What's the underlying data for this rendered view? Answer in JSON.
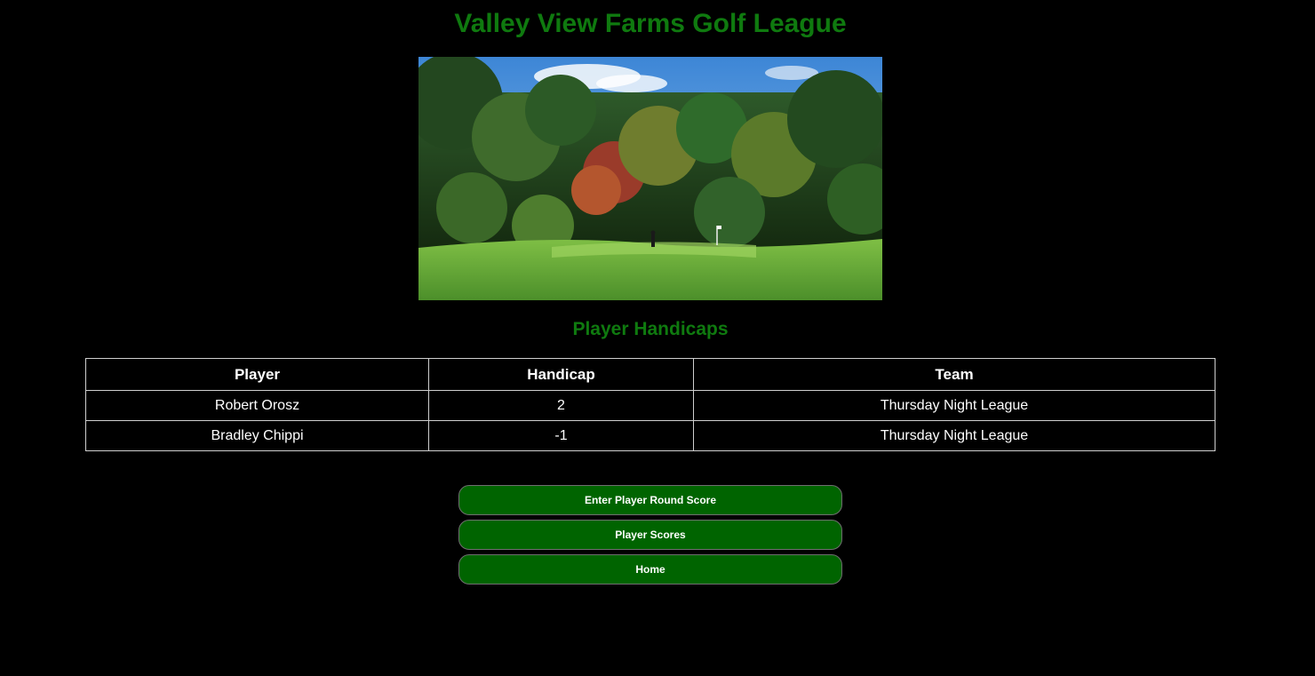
{
  "header": {
    "title": "Valley View Farms Golf League"
  },
  "hero": {
    "alt": "golf course green with trees"
  },
  "handicaps": {
    "title": "Player Handicaps",
    "columns": [
      "Player",
      "Handicap",
      "Team"
    ],
    "rows": [
      {
        "player": "Robert Orosz",
        "handicap": "2",
        "team": "Thursday Night League"
      },
      {
        "player": "Bradley Chippi",
        "handicap": "-1",
        "team": "Thursday Night League"
      }
    ]
  },
  "actions": {
    "enter_score": "Enter Player Round Score",
    "player_scores": "Player Scores",
    "home": "Home"
  },
  "colors": {
    "background": "#000000",
    "title_green": "#0f7a0f",
    "button_green": "#006400"
  }
}
